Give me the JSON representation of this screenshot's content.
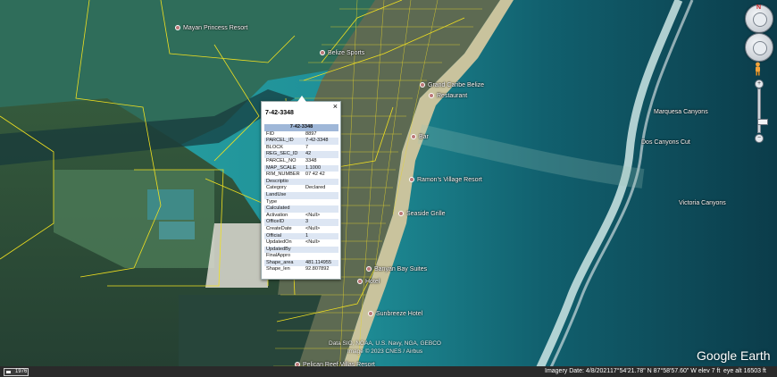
{
  "popup": {
    "title": "7-42-3348",
    "close_glyph": "×",
    "header": "7-42-3348",
    "fields": [
      {
        "key": "FID",
        "value": "8897"
      },
      {
        "key": "PARCEL_ID",
        "value": "7-42-3348"
      },
      {
        "key": "BLOCK",
        "value": "7"
      },
      {
        "key": "REG_SEC_ID",
        "value": "42"
      },
      {
        "key": "PARCEL_NO",
        "value": "3348"
      },
      {
        "key": "MAP_SCALE",
        "value": "1.1000"
      },
      {
        "key": "RIM_NUMBER",
        "value": "07 42 42"
      },
      {
        "key": "Descriptio",
        "value": ""
      },
      {
        "key": "Category",
        "value": "Declared"
      },
      {
        "key": "LandUse",
        "value": ""
      },
      {
        "key": "Type",
        "value": ""
      },
      {
        "key": "Calculated",
        "value": ""
      },
      {
        "key": "Activation",
        "value": "<Null>"
      },
      {
        "key": "OfficeID",
        "value": "3"
      },
      {
        "key": "CreateDate",
        "value": "<Null>"
      },
      {
        "key": "Official",
        "value": "1"
      },
      {
        "key": "UpdatedOn",
        "value": "<Null>"
      },
      {
        "key": "UpdatedBy",
        "value": ""
      },
      {
        "key": "FinalAppro",
        "value": ""
      },
      {
        "key": "Shape_area",
        "value": "481.114955"
      },
      {
        "key": "Shape_len",
        "value": "92.807892"
      }
    ]
  },
  "places": [
    "Mayan Princess Resort",
    "Belize Sports",
    "Grand Caribe Belize",
    "Restaurant",
    "Bar",
    "Ramon's Village Resort",
    "Seaside Grille",
    "Banyan Bay Suites",
    "Hotel",
    "Sunbreeze Hotel",
    "Pelican Reef Villas Resort"
  ],
  "reef_labels": [
    "Marquesa Canyons",
    "Dos Canyons Cut",
    "Victoria Canyons"
  ],
  "status_bar": {
    "scale_text": "1976",
    "imagery_date": "Imagery Date: 4/8/2021",
    "coordinates": "17°54'21.78\" N   87°58'57.60\" W  elev   7 ft",
    "eye_alt": "eye alt  16503 ft"
  },
  "attribution": [
    "Data SIO, NOAA, U.S. Navy, NGA, GEBCO",
    "Image © 2023 CNES / Airbus"
  ],
  "brand": "Google Earth",
  "navigation": {
    "north_label": "N",
    "zoom_in": "+",
    "zoom_out": "−"
  },
  "colors": {
    "parcel_outline": "#f0e020",
    "deep_sea": "#0b3c4a",
    "lagoon": "#2aa7a3",
    "reef_foam": "#d9f0ee",
    "popup_header": "#9fb7d8"
  }
}
